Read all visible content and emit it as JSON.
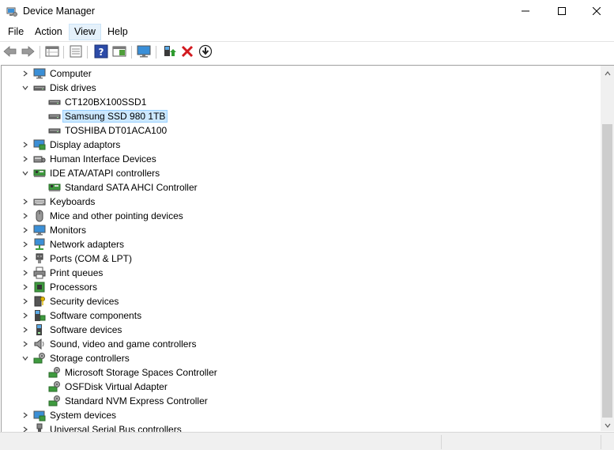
{
  "window": {
    "title": "Device Manager",
    "icon": "device-manager-icon",
    "controls": [
      "minimize-icon",
      "maximize-icon",
      "close-icon"
    ]
  },
  "menu": [
    {
      "label": "File",
      "active": false
    },
    {
      "label": "Action",
      "active": false
    },
    {
      "label": "View",
      "active": true
    },
    {
      "label": "Help",
      "active": false
    }
  ],
  "toolbar": [
    "back-arrow-icon",
    "forward-arrow-icon",
    "properties-grid-icon",
    "document-icon",
    "help-icon",
    "details-pane-icon",
    "scan-monitor-icon",
    "update-driver-icon",
    "uninstall-x-icon",
    "download-driver-icon"
  ],
  "tree": [
    {
      "label": "Computer",
      "level": 0,
      "expanded": false,
      "icon": "computer-icon"
    },
    {
      "label": "Disk drives",
      "level": 0,
      "expanded": true,
      "icon": "disk-drive-icon"
    },
    {
      "label": "CT120BX100SSD1",
      "level": 1,
      "icon": "disk-drive-icon"
    },
    {
      "label": "Samsung SSD 980 1TB",
      "level": 1,
      "icon": "disk-drive-icon",
      "selected": true
    },
    {
      "label": "TOSHIBA DT01ACA100",
      "level": 1,
      "icon": "disk-drive-icon"
    },
    {
      "label": "Display adaptors",
      "level": 0,
      "expanded": false,
      "icon": "display-adapter-icon"
    },
    {
      "label": "Human Interface Devices",
      "level": 0,
      "expanded": false,
      "icon": "hid-icon"
    },
    {
      "label": "IDE ATA/ATAPI controllers",
      "level": 0,
      "expanded": true,
      "icon": "ide-controller-icon"
    },
    {
      "label": "Standard SATA AHCI Controller",
      "level": 1,
      "icon": "ide-controller-icon"
    },
    {
      "label": "Keyboards",
      "level": 0,
      "expanded": false,
      "icon": "keyboard-icon"
    },
    {
      "label": "Mice and other pointing devices",
      "level": 0,
      "expanded": false,
      "icon": "mouse-icon"
    },
    {
      "label": "Monitors",
      "level": 0,
      "expanded": false,
      "icon": "monitor-icon"
    },
    {
      "label": "Network adapters",
      "level": 0,
      "expanded": false,
      "icon": "network-adapter-icon"
    },
    {
      "label": "Ports (COM & LPT)",
      "level": 0,
      "expanded": false,
      "icon": "port-icon"
    },
    {
      "label": "Print queues",
      "level": 0,
      "expanded": false,
      "icon": "printer-icon"
    },
    {
      "label": "Processors",
      "level": 0,
      "expanded": false,
      "icon": "processor-icon"
    },
    {
      "label": "Security devices",
      "level": 0,
      "expanded": false,
      "icon": "security-key-icon"
    },
    {
      "label": "Software components",
      "level": 0,
      "expanded": false,
      "icon": "software-component-icon"
    },
    {
      "label": "Software devices",
      "level": 0,
      "expanded": false,
      "icon": "software-device-icon"
    },
    {
      "label": "Sound, video and game controllers",
      "level": 0,
      "expanded": false,
      "icon": "speaker-icon"
    },
    {
      "label": "Storage controllers",
      "level": 0,
      "expanded": true,
      "icon": "storage-controller-icon"
    },
    {
      "label": "Microsoft Storage Spaces Controller",
      "level": 1,
      "icon": "storage-controller-icon"
    },
    {
      "label": "OSFDisk Virtual Adapter",
      "level": 1,
      "icon": "storage-controller-icon"
    },
    {
      "label": "Standard NVM Express Controller",
      "level": 1,
      "icon": "storage-controller-icon"
    },
    {
      "label": "System devices",
      "level": 0,
      "expanded": false,
      "icon": "system-device-icon"
    },
    {
      "label": "Universal Serial Bus controllers",
      "level": 0,
      "expanded": false,
      "icon": "usb-icon"
    }
  ],
  "colors": {
    "selection_bg": "#cce8ff",
    "selection_border": "#99d1ff",
    "menu_active_bg": "#e5f1fb",
    "scrollbar_bg": "#f0f0f0",
    "scroll_thumb": "#cdcdcd"
  }
}
